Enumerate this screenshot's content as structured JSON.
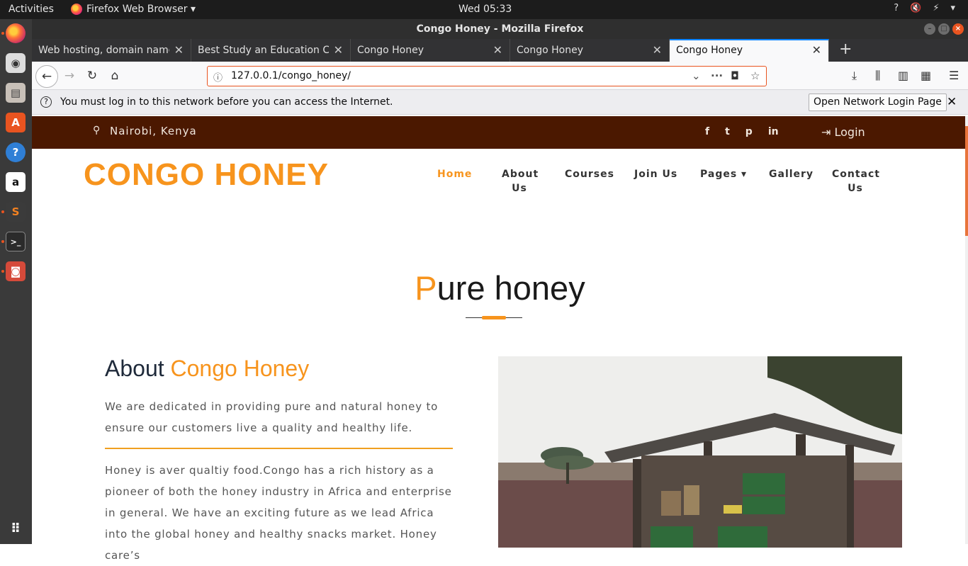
{
  "desktop": {
    "activities": "Activities",
    "app_menu": "Firefox Web Browser ▾",
    "clock": "Wed 05:33",
    "tray": [
      "?",
      "🔇",
      "⚡",
      "▾"
    ]
  },
  "window": {
    "title": "Congo Honey - Mozilla Firefox"
  },
  "tabs": [
    {
      "label": "Web hosting, domain name"
    },
    {
      "label": "Best Study an Education Cat"
    },
    {
      "label": "Congo Honey"
    },
    {
      "label": "Congo Honey"
    },
    {
      "label": "Congo Honey"
    }
  ],
  "urlbar": {
    "url": "127.0.0.1/congo_honey/"
  },
  "notification": {
    "message": "You must log in to this network before you can access the Internet.",
    "button": "Open Network Login Page"
  },
  "site": {
    "location": "Nairobi, Kenya",
    "social": [
      "f",
      "t",
      "p",
      "in"
    ],
    "login": "Login",
    "logo": "CONGO HONEY",
    "menu": {
      "home": "Home",
      "about": "About Us",
      "courses": "Courses",
      "join": "Join Us",
      "pages": "Pages ▾",
      "gallery": "Gallery",
      "contact": "Contact Us"
    },
    "section_title_first": "P",
    "section_title_rest": "ure honey",
    "about_title": "About",
    "about_title_hl": "Congo Honey",
    "about_para1": "We are dedicated in providing pure and natural honey to ensure our customers live a quality and healthy life.",
    "about_para2": "Honey is aver qualtiy food.Congo has a rich history as a pioneer of both the honey industry in Africa and enterprise in general. We have an exciting future as we lead Africa into the global honey and healthy snacks market. Honey care’s"
  },
  "colors": {
    "accent": "#f7941d",
    "topbar_brown": "#4b1800"
  }
}
